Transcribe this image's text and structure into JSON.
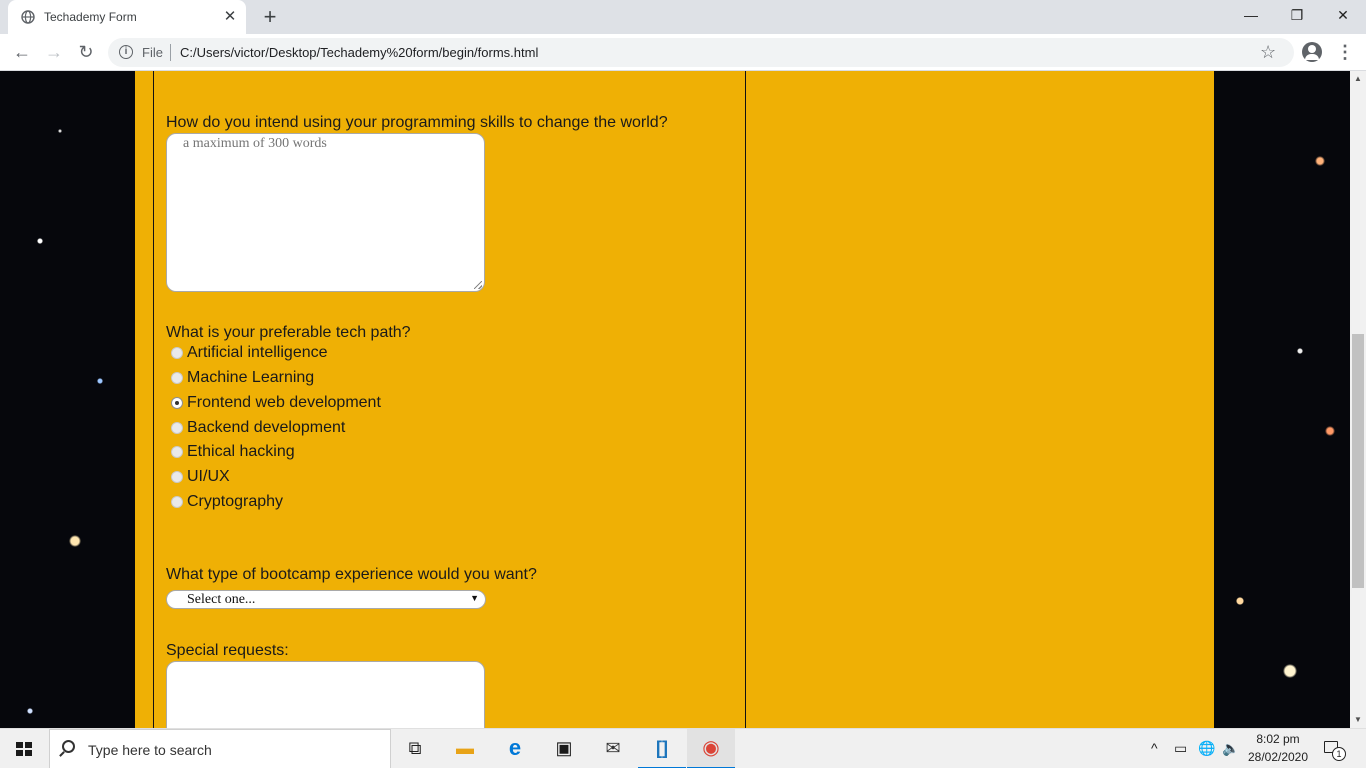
{
  "browser": {
    "tab_title": "Techademy Form",
    "omnibox_scheme_label": "File",
    "url": "C:/Users/victor/Desktop/Techademy%20form/begin/forms.html"
  },
  "form": {
    "q_world": "How do you intend using your programming skills to change the world?",
    "q_world_placeholder": "a maximum of 300 words",
    "q_tech_path": "What is your preferable tech path?",
    "tech_paths": [
      {
        "label": "Artificial intelligence",
        "checked": false
      },
      {
        "label": "Machine Learning",
        "checked": false
      },
      {
        "label": "Frontend web development",
        "checked": true
      },
      {
        "label": "Backend development",
        "checked": false
      },
      {
        "label": "Ethical hacking",
        "checked": false
      },
      {
        "label": "UI/UX",
        "checked": false
      },
      {
        "label": "Cryptography",
        "checked": false
      }
    ],
    "q_bootcamp": "What type of bootcamp experience would you want?",
    "bootcamp_selected": "Select one...",
    "q_special": "Special requests:"
  },
  "taskbar": {
    "search_placeholder": "Type here to search",
    "apps": [
      {
        "name": "task-view",
        "glyph": "⧉",
        "color": "#222222"
      },
      {
        "name": "file-explorer",
        "glyph": "▬",
        "color": "#e8a317"
      },
      {
        "name": "edge",
        "glyph": "e",
        "color": "#0078d7"
      },
      {
        "name": "store",
        "glyph": "▣",
        "color": "#1a1a1a"
      },
      {
        "name": "mail",
        "glyph": "✉",
        "color": "#333333"
      },
      {
        "name": "brackets",
        "glyph": "[]",
        "color": "#1c75bc"
      },
      {
        "name": "chrome",
        "glyph": "◉",
        "color": "#db4437"
      }
    ],
    "time": "8:02 pm",
    "date": "28/02/2020",
    "notification_count": "1"
  },
  "colors": {
    "form_background": "#efb005",
    "page_background": "#06070c"
  }
}
